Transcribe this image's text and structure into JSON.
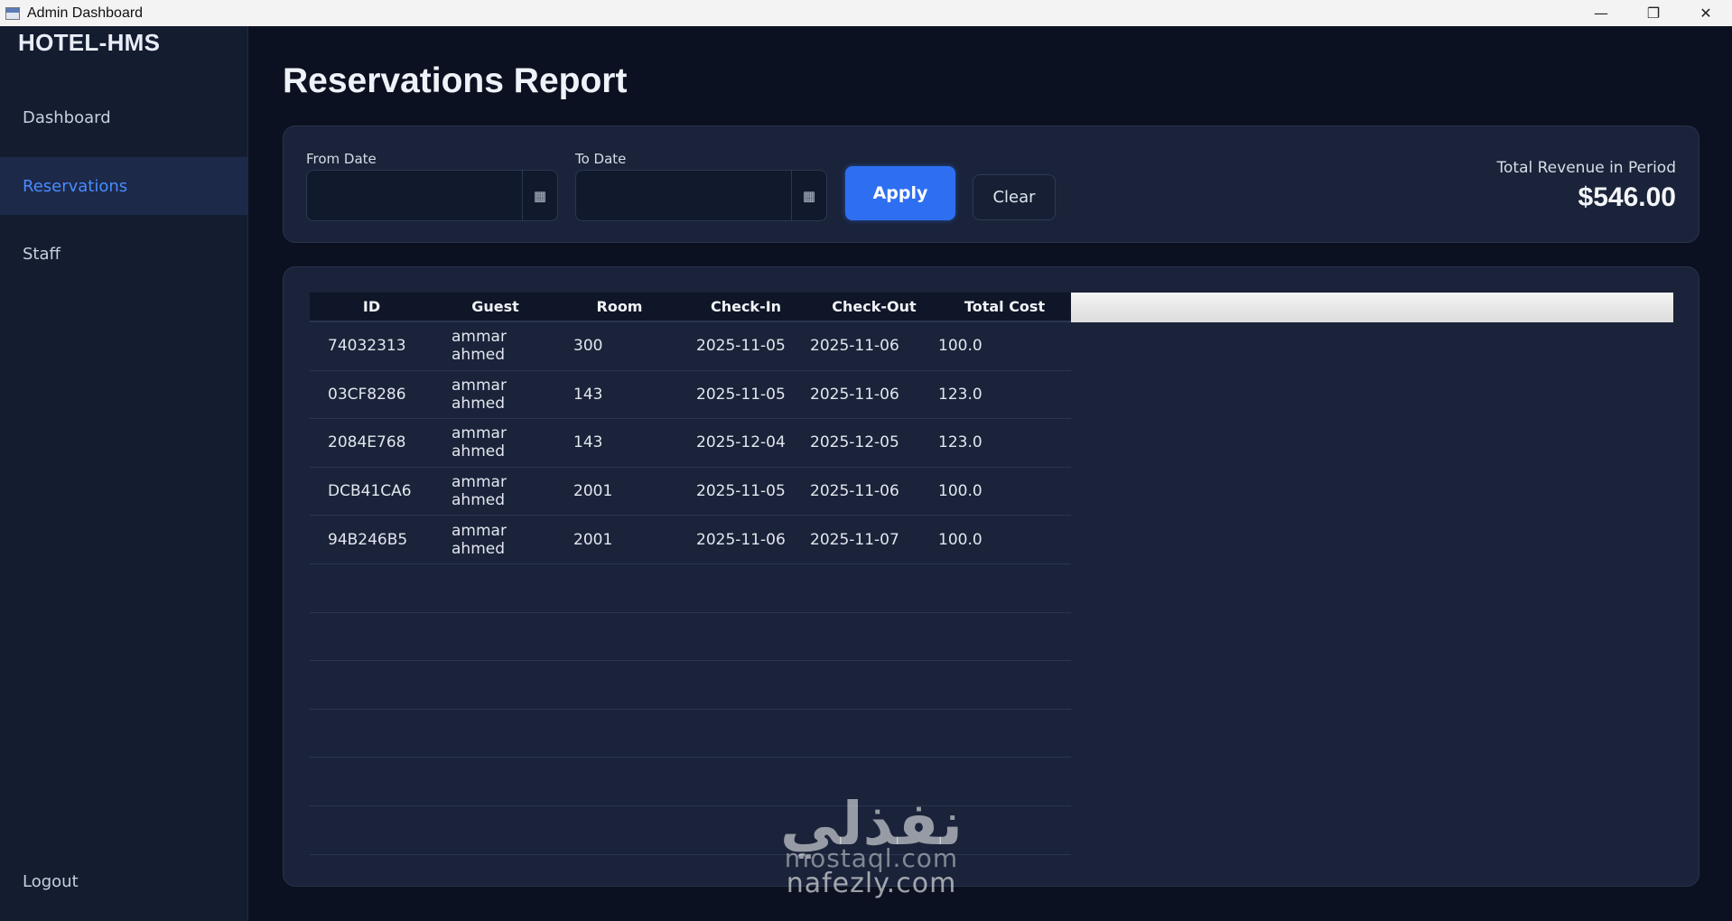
{
  "window": {
    "title": "Admin Dashboard",
    "minimize": "—",
    "restore": "❐",
    "close": "✕"
  },
  "sidebar": {
    "brand": "HOTEL-HMS",
    "items": [
      {
        "label": "Dashboard"
      },
      {
        "label": "Reservations",
        "active": true
      },
      {
        "label": "Staff"
      }
    ],
    "logout": "Logout"
  },
  "main": {
    "title": "Reservations Report",
    "filters": {
      "from_label": "From Date",
      "from_value": "",
      "to_label": "To Date",
      "to_value": "",
      "calendar_icon": "calendar-icon",
      "apply_label": "Apply",
      "clear_label": "Clear"
    },
    "revenue": {
      "label": "Total Revenue in Period",
      "value": "$546.00"
    },
    "table": {
      "columns": [
        "ID",
        "Guest",
        "Room",
        "Check-In",
        "Check-Out",
        "Total Cost"
      ],
      "rows": [
        [
          "74032313",
          "ammar ahmed",
          "300",
          "2025-11-05",
          "2025-11-06",
          "100.0"
        ],
        [
          "03CF8286",
          "ammar ahmed",
          "143",
          "2025-11-05",
          "2025-11-06",
          "123.0"
        ],
        [
          "2084E768",
          "ammar ahmed",
          "143",
          "2025-12-04",
          "2025-12-05",
          "123.0"
        ],
        [
          "DCB41CA6",
          "ammar ahmed",
          "2001",
          "2025-11-05",
          "2025-11-06",
          "100.0"
        ],
        [
          "94B246B5",
          "ammar ahmed",
          "2001",
          "2025-11-06",
          "2025-11-07",
          "100.0"
        ],
        [
          "",
          "",
          "",
          "",
          "",
          ""
        ],
        [
          "",
          "",
          "",
          "",
          "",
          ""
        ],
        [
          "",
          "",
          "",
          "",
          "",
          ""
        ],
        [
          "",
          "",
          "",
          "",
          "",
          ""
        ],
        [
          "",
          "",
          "",
          "",
          "",
          ""
        ],
        [
          "",
          "",
          "",
          "",
          "",
          ""
        ]
      ]
    }
  },
  "watermark": {
    "arabic": "نفذلي",
    "site1": "mostaql.com",
    "site2": "nafezly.com"
  },
  "colors": {
    "accent": "#2e6ff2",
    "active_nav": "#4a8bff",
    "background": "#0b1120",
    "card": "#1a2339"
  }
}
